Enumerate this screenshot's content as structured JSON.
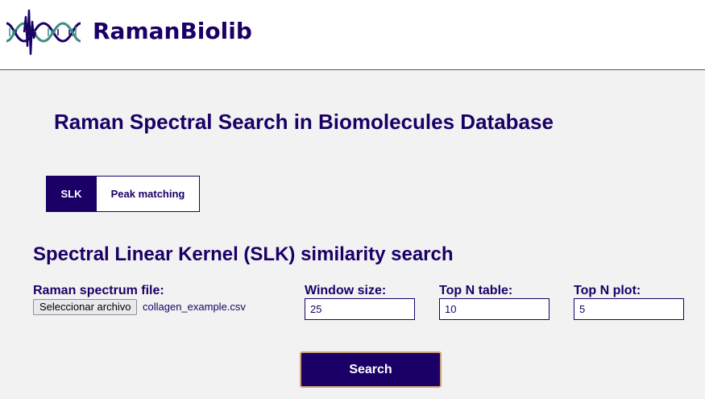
{
  "header": {
    "brand": "RamanBiolib",
    "logo_icon": "dna-spectrum-logo-icon"
  },
  "page_title": "Raman Spectral Search in Biomolecules Database",
  "tabs": [
    {
      "label": "SLK",
      "active": true
    },
    {
      "label": "Peak matching",
      "active": false
    }
  ],
  "section_title": "Spectral Linear Kernel (SLK) similarity search",
  "form": {
    "file": {
      "label": "Raman spectrum file:",
      "button_label": "Seleccionar archivo",
      "file_name": "collagen_example.csv"
    },
    "window_size": {
      "label": "Window size:",
      "value": "25"
    },
    "top_n_table": {
      "label": "Top N table:",
      "value": "10"
    },
    "top_n_plot": {
      "label": "Top N plot:",
      "value": "5"
    },
    "search_label": "Search"
  },
  "colors": {
    "primary": "#1a0066",
    "background": "#f2f2f2",
    "logo_teal": "#3d8c84",
    "button_border": "#c9a07a"
  }
}
